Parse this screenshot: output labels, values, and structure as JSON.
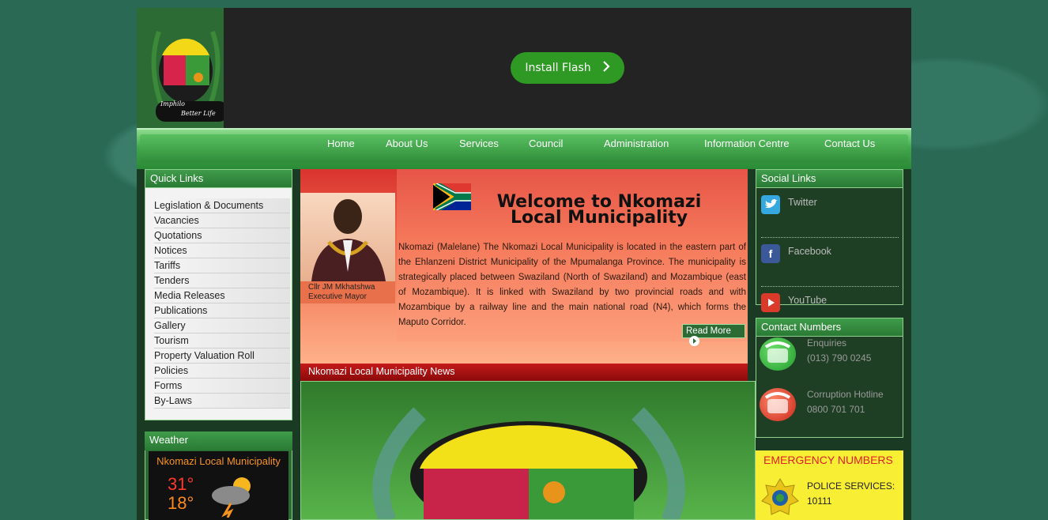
{
  "header": {
    "logo_motto": "Imphilo Better Life",
    "flash_button_label": "Install Flash"
  },
  "nav": {
    "items": [
      "Home",
      "About Us",
      "Services",
      "Council",
      "Administration",
      "Information Centre",
      "Contact Us"
    ]
  },
  "quick_links": {
    "title": "Quick Links",
    "items": [
      "Legislation & Documents",
      "Vacancies",
      "Quotations",
      "Notices",
      "Tariffs",
      "Tenders",
      "Media Releases",
      "Publications",
      "Gallery",
      "Tourism",
      "Property Valuation Roll",
      "Policies",
      "Forms",
      "By-Laws"
    ]
  },
  "weather": {
    "title": "Weather",
    "location": "Nkomazi Local Municipality",
    "high": "31°",
    "low": "18°"
  },
  "welcome": {
    "title": "Welcome to Nkomazi Local Municipality",
    "mayor_name": "Cllr JM Mkhatshwa",
    "mayor_title": "Executive Mayor",
    "intro": "Nkomazi (Malelane) The Nkomazi Local Municipality is located in the eastern part of the Ehlanzeni District Municipality of the Mpumalanga Province. The municipality is strategically placed between Swaziland (North of Swaziland) and Mozambique (east of Mozambique). It is linked with Swaziland by two provincial roads and with Mozambique by a railway line and the main national road (N4), which forms the Maputo Corridor.",
    "read_more": "Read More"
  },
  "news": {
    "title": "Nkomazi Local Municipality News"
  },
  "social": {
    "title": "Social Links",
    "items": [
      "Twitter",
      "Facebook",
      "YouTube"
    ]
  },
  "contact": {
    "title": "Contact Numbers",
    "enquiries_label": "Enquiries",
    "enquiries_number": "(013) 790 0245",
    "hotline_label": "Corruption Hotline",
    "hotline_number": "0800 701 701"
  },
  "emergency": {
    "title": "EMERGENCY NUMBERS",
    "police_label": "POLICE SERVICES:",
    "police_number": "10111"
  },
  "colors": {
    "accent_green": "#2e9a24",
    "news_red": "#c51a1a",
    "emergency_yellow": "#f8ee33"
  }
}
